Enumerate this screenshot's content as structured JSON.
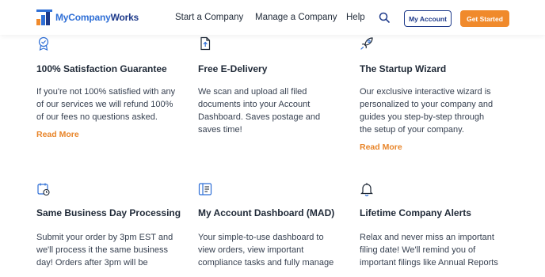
{
  "header": {
    "logo": {
      "text_my": "My",
      "text_company": "Company",
      "text_works": "Works"
    },
    "nav": [
      {
        "label": "Start a Company"
      },
      {
        "label": "Manage a Company"
      },
      {
        "label": "Help"
      }
    ],
    "search_icon": "search-icon",
    "account_button": "My Account",
    "started_button": "Get Started",
    "colors": {
      "brand_blue": "#2f6fd6",
      "navy": "#1e3a8a",
      "accent_orange": "#f08a2c"
    }
  },
  "features": [
    {
      "icon": "badge-check-icon",
      "title": "100% Satisfaction Guarantee",
      "lines": [
        "If you're not 100% satisfied with any",
        "of our services we will refund 100%",
        "of our fees no questions asked."
      ],
      "link": "Read More"
    },
    {
      "icon": "document-upload-icon",
      "title": "Free E-Delivery",
      "lines": [
        "We scan and upload all filed",
        "documents into your Account",
        "Dashboard. Saves postage and",
        "saves time!"
      ]
    },
    {
      "icon": "rocket-icon",
      "title": "The Startup Wizard",
      "lines": [
        "Our exclusive interactive wizard is",
        "personalized to your company and",
        "guides you step-by-step through",
        "the setup of your company."
      ],
      "link": "Read More"
    },
    {
      "icon": "calendar-clock-icon",
      "title": "Same Business Day Processing",
      "lines": [
        "Submit your order by 3pm EST and",
        "we'll process it the same business",
        "day! Orders after 3pm will be"
      ]
    },
    {
      "icon": "dashboard-icon",
      "title": "My Account Dashboard (MAD)",
      "lines": [
        "Your simple-to-use dashboard to",
        "view orders, view important",
        "compliance tasks and fully manage"
      ]
    },
    {
      "icon": "bell-icon",
      "title": "Lifetime Company Alerts",
      "lines": [
        "Relax and never miss an important",
        "filing date! We'll remind you of",
        "important filings like Annual Reports"
      ]
    }
  ]
}
